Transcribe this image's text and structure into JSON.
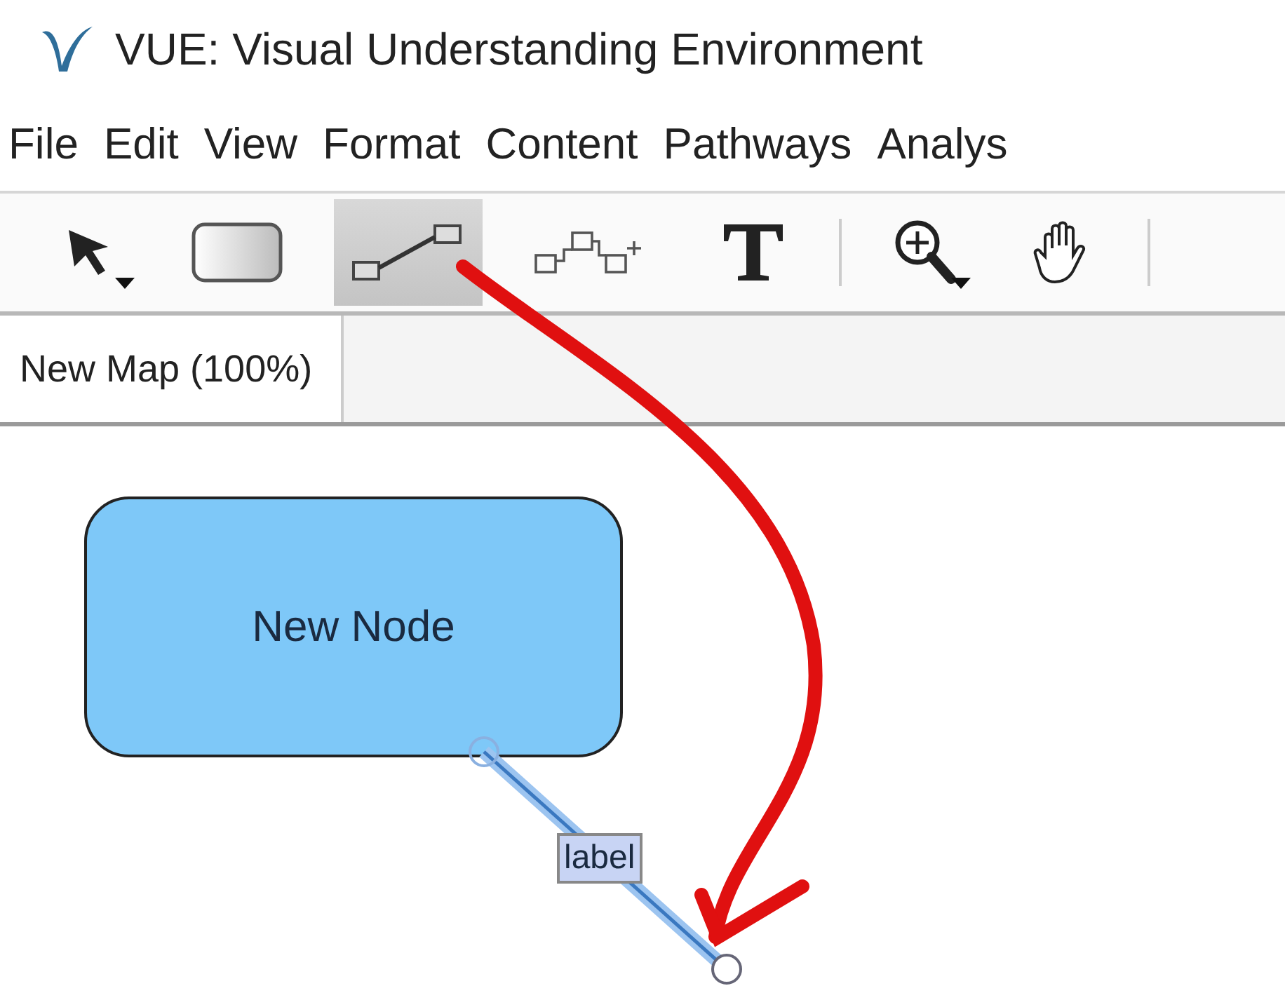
{
  "window": {
    "title": "VUE: Visual Understanding Environment"
  },
  "menu": [
    "File",
    "Edit",
    "View",
    "Format",
    "Content",
    "Pathways",
    "Analys"
  ],
  "toolbar": [
    {
      "kind": "pointer",
      "selected": false,
      "has_menu": true
    },
    {
      "kind": "node",
      "selected": false,
      "has_menu": false
    },
    {
      "kind": "link",
      "selected": true,
      "has_menu": false
    },
    {
      "kind": "multi-node",
      "selected": false,
      "has_menu": false
    },
    {
      "kind": "text",
      "selected": false,
      "has_menu": false
    },
    {
      "kind": "separator"
    },
    {
      "kind": "zoom",
      "selected": false,
      "has_menu": true
    },
    {
      "kind": "hand",
      "selected": false,
      "has_menu": false
    },
    {
      "kind": "separator"
    }
  ],
  "tabs": [
    {
      "label": "New Map (100%)",
      "selected": true
    }
  ],
  "canvas": {
    "node": {
      "label": "New Node"
    },
    "link": {
      "label": "label"
    }
  }
}
